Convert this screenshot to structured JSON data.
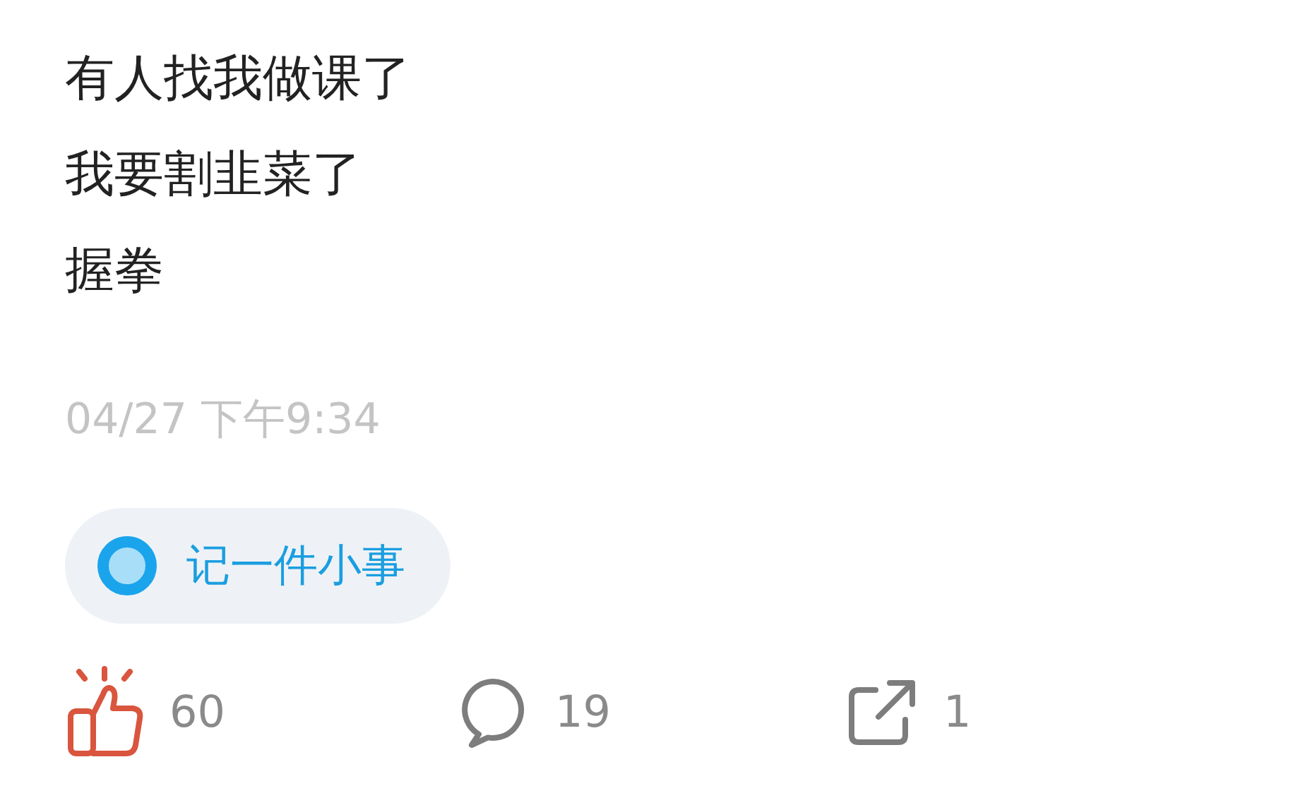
{
  "post": {
    "lines": [
      "有人找我做课了",
      "我要割韭菜了",
      "握拳"
    ],
    "timestamp": "04/27 下午9:34"
  },
  "tag": {
    "label": "记一件小事"
  },
  "actions": [
    {
      "kind": "like",
      "count": "60",
      "selected": true
    },
    {
      "kind": "comment",
      "count": "19"
    },
    {
      "kind": "share",
      "count": "1"
    }
  ]
}
